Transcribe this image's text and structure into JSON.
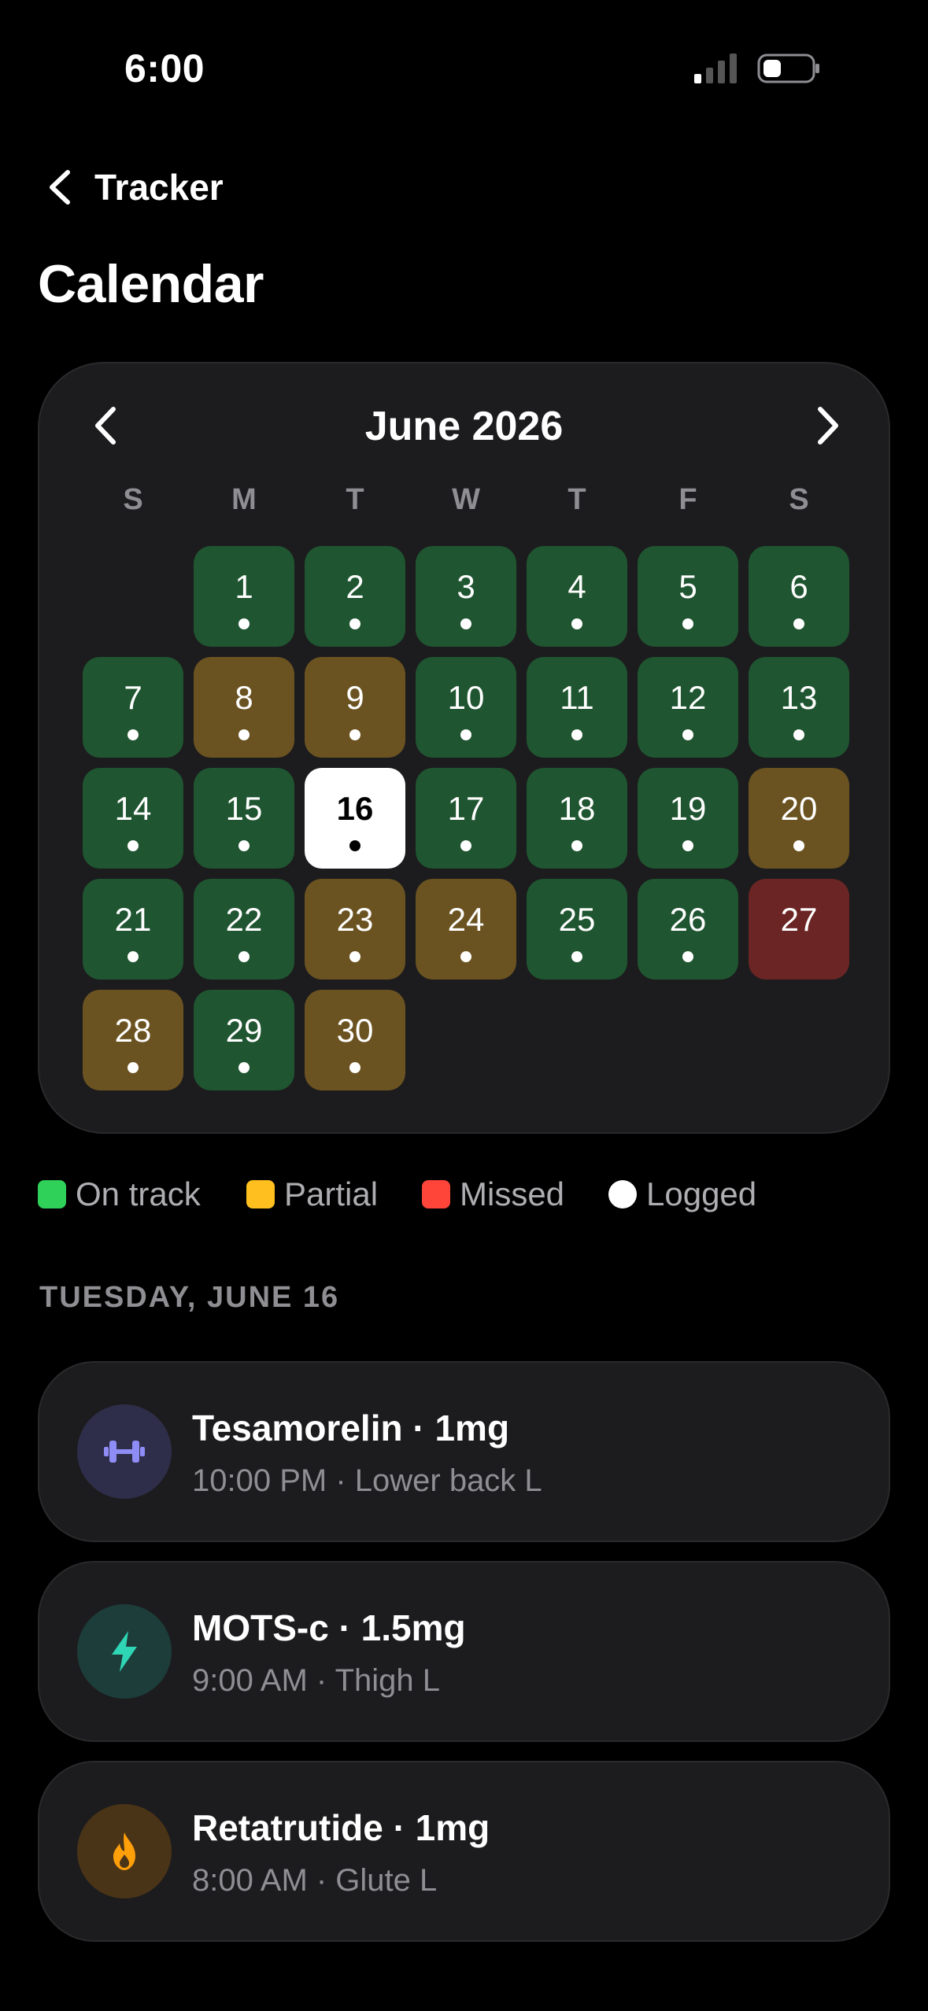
{
  "status_bar": {
    "time": "6:00"
  },
  "nav": {
    "back_label": "Tracker"
  },
  "page": {
    "title": "Calendar"
  },
  "calendar": {
    "month_label": "June 2026",
    "weekdays": [
      "S",
      "M",
      "T",
      "W",
      "T",
      "F",
      "S"
    ],
    "days": [
      {
        "day": "1",
        "status": "on-track",
        "logged": true
      },
      {
        "day": "2",
        "status": "on-track",
        "logged": true
      },
      {
        "day": "3",
        "status": "on-track",
        "logged": true
      },
      {
        "day": "4",
        "status": "on-track",
        "logged": true
      },
      {
        "day": "5",
        "status": "on-track",
        "logged": true
      },
      {
        "day": "6",
        "status": "on-track",
        "logged": true
      },
      {
        "day": "7",
        "status": "on-track",
        "logged": true
      },
      {
        "day": "8",
        "status": "partial",
        "logged": true
      },
      {
        "day": "9",
        "status": "partial",
        "logged": true
      },
      {
        "day": "10",
        "status": "on-track",
        "logged": true
      },
      {
        "day": "11",
        "status": "on-track",
        "logged": true
      },
      {
        "day": "12",
        "status": "on-track",
        "logged": true
      },
      {
        "day": "13",
        "status": "on-track",
        "logged": true
      },
      {
        "day": "14",
        "status": "on-track",
        "logged": true
      },
      {
        "day": "15",
        "status": "on-track",
        "logged": true
      },
      {
        "day": "16",
        "status": "selected",
        "logged": true
      },
      {
        "day": "17",
        "status": "on-track",
        "logged": true
      },
      {
        "day": "18",
        "status": "on-track",
        "logged": true
      },
      {
        "day": "19",
        "status": "on-track",
        "logged": true
      },
      {
        "day": "20",
        "status": "partial",
        "logged": true
      },
      {
        "day": "21",
        "status": "on-track",
        "logged": true
      },
      {
        "day": "22",
        "status": "on-track",
        "logged": true
      },
      {
        "day": "23",
        "status": "partial",
        "logged": true
      },
      {
        "day": "24",
        "status": "partial",
        "logged": true
      },
      {
        "day": "25",
        "status": "on-track",
        "logged": true
      },
      {
        "day": "26",
        "status": "on-track",
        "logged": true
      },
      {
        "day": "27",
        "status": "missed",
        "logged": false
      },
      {
        "day": "28",
        "status": "partial",
        "logged": true
      },
      {
        "day": "29",
        "status": "on-track",
        "logged": true
      },
      {
        "day": "30",
        "status": "partial",
        "logged": true
      }
    ]
  },
  "legend": [
    {
      "label": "On track",
      "color": "#30d158",
      "shape": "square"
    },
    {
      "label": "Partial",
      "color": "#ffc01f",
      "shape": "square"
    },
    {
      "label": "Missed",
      "color": "#ff453a",
      "shape": "square"
    },
    {
      "label": "Logged",
      "color": "#ffffff",
      "shape": "circle"
    }
  ],
  "selected_day": {
    "heading": "TUESDAY, JUNE 16"
  },
  "entries": [
    {
      "title": "Tesamorelin · 1mg",
      "subtitle": "10:00 PM · Lower back L",
      "icon": "dumbbell-icon",
      "icon_color": "#8e8cf5",
      "icon_bg": "#2e2e4a"
    },
    {
      "title": "MOTS-c · 1.5mg",
      "subtitle": "9:00 AM · Thigh L",
      "icon": "bolt-icon",
      "icon_color": "#2fd6b5",
      "icon_bg": "#1d3d3b"
    },
    {
      "title": "Retatrutide · 1mg",
      "subtitle": "8:00 AM · Glute L",
      "icon": "flame-icon",
      "icon_color": "#ff9f0a",
      "icon_bg": "#4a3417"
    }
  ],
  "colors": {
    "on_track_cell": "#1f5530",
    "partial_cell": "#6b5321",
    "missed_cell": "#6a2524",
    "card_bg": "#1c1c1e"
  }
}
